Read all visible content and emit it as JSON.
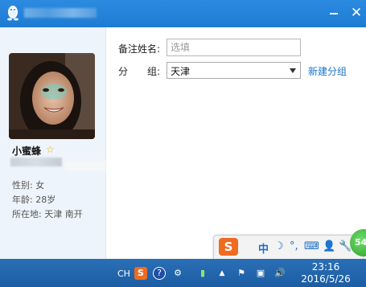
{
  "form": {
    "remark_label": "备注姓名:",
    "remark_placeholder": "选填",
    "group_label": "分　　组:",
    "group_value": "天津",
    "new_group_link": "新建分组"
  },
  "profile": {
    "nickname": "小蜜蜂",
    "gender": "性别: 女",
    "age": "年龄: 28岁",
    "location": "所在地: 天津  南开"
  },
  "ime": {
    "logo": "S",
    "mode": "中",
    "moon": "☽",
    "punct": "°,",
    "keyboard": "⌨",
    "user": "👤",
    "tool": "🔧"
  },
  "badge": {
    "value": "54"
  },
  "taskbar": {
    "lang": "CH",
    "sogou": "S",
    "help": "?",
    "time": "23:16",
    "date": "2016/5/26"
  },
  "colors": {
    "titlebar": "#1e7bd3",
    "link": "#1a73c9",
    "taskbar": "#1c5da3",
    "ime_orange": "#f06a1f"
  }
}
